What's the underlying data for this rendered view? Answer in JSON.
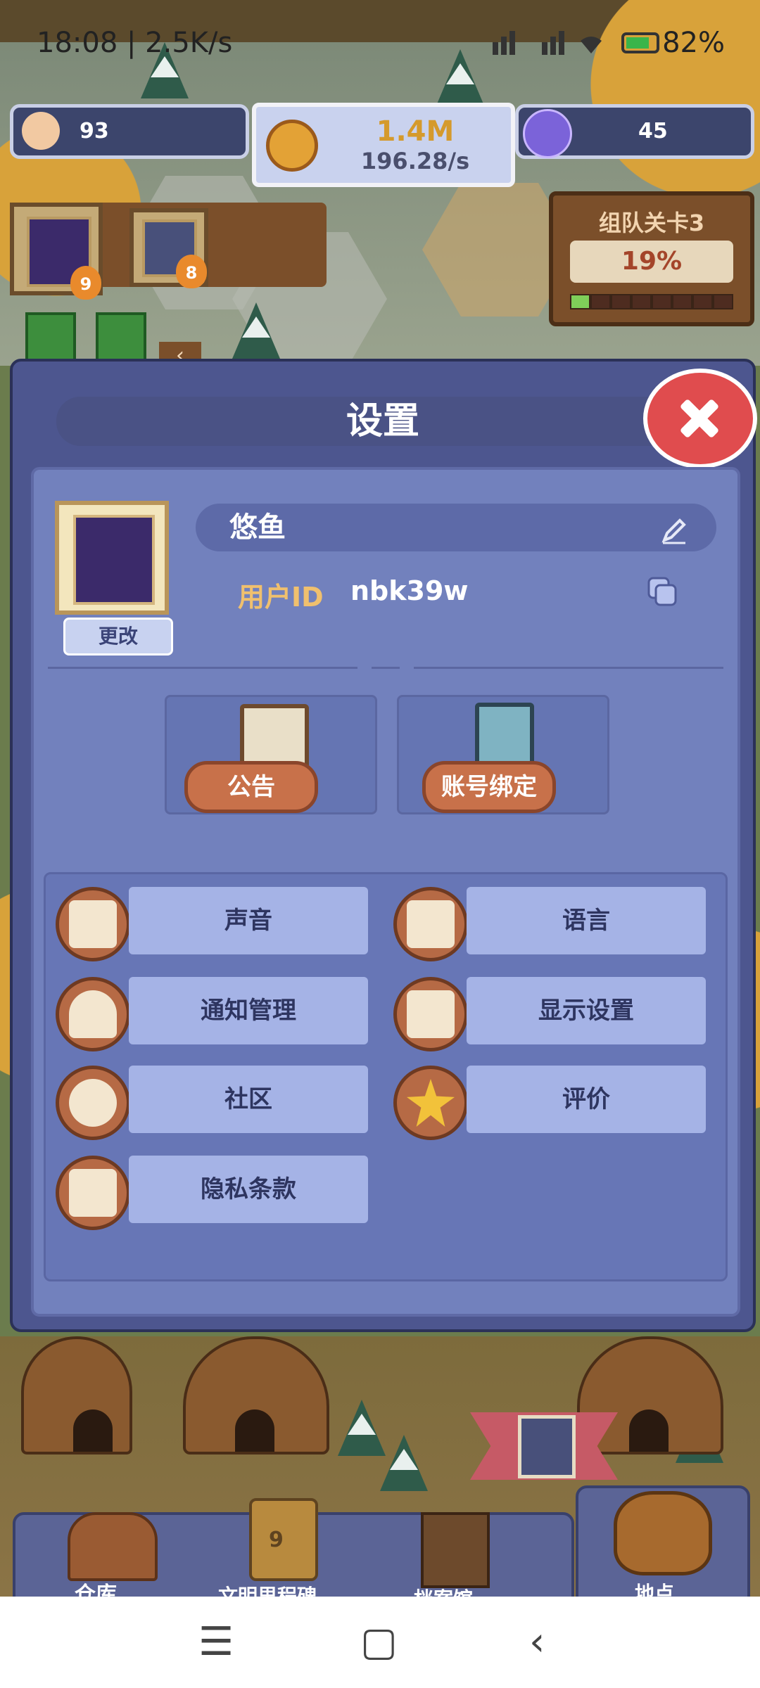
{
  "status_bar": {
    "time": "18:08 | 2.5K/s",
    "battery": "82%"
  },
  "hud": {
    "population": "93",
    "coins": "1.4M",
    "coin_rate": "196.28/s",
    "gems": "45"
  },
  "banners": [
    {
      "level": "9"
    },
    {
      "level": "8"
    }
  ],
  "team_stage": {
    "title": "组队关卡3",
    "progress": "19%",
    "progress_fraction": 0.19
  },
  "settings": {
    "title": "设置",
    "nickname": "悠鱼",
    "change_label": "更改",
    "user_id_label": "用户ID",
    "user_id": "nbk39w",
    "cards": [
      {
        "label": "公告",
        "icon": "notice-board-icon"
      },
      {
        "label": "账号绑定",
        "icon": "account-card-icon"
      }
    ],
    "items": [
      {
        "label": "声音",
        "icon": "music-note-icon"
      },
      {
        "label": "语言",
        "icon": "language-icon"
      },
      {
        "label": "通知管理",
        "icon": "bell-icon"
      },
      {
        "label": "显示设置",
        "icon": "display-icon"
      },
      {
        "label": "社区",
        "icon": "community-icon"
      },
      {
        "label": "评价",
        "icon": "star-icon"
      },
      {
        "label": "隐私条款",
        "icon": "privacy-lock-icon"
      }
    ]
  },
  "bottom_nav": [
    {
      "label": "仓库"
    },
    {
      "label": "文明里程碑",
      "badge": "9"
    },
    {
      "label": "档案馆"
    },
    {
      "label": "地点"
    }
  ],
  "colors": {
    "dialog": "#4d568f",
    "inner": "#7281bd",
    "close": "#e04c4e",
    "accent": "#f0c06e"
  }
}
